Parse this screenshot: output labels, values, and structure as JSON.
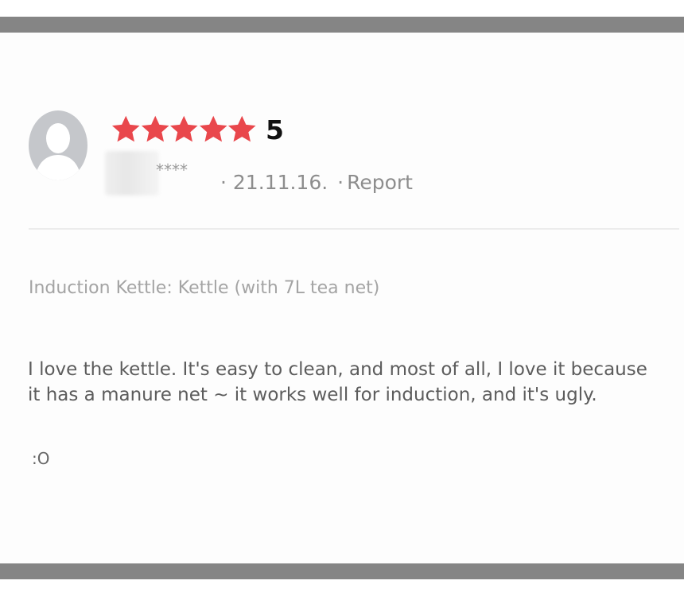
{
  "colors": {
    "bar": "#858585",
    "star": "#e9474c",
    "avatar_bg": "#c5c7cb",
    "avatar_fg": "#ffffff"
  },
  "review": {
    "rating": {
      "value": 5,
      "max": 5,
      "label": "5"
    },
    "reviewer_masked": "****",
    "date": "21.11.16.",
    "separator": "·",
    "report_label": "Report",
    "option_text": "Induction Kettle: Kettle (with 7L tea net)",
    "body": "I love the kettle. It's easy to clean, and most of all, I love it because it has a manure net ~ it works well for induction, and it's ugly.",
    "emote": ":O"
  },
  "icons": {
    "avatar": "person-silhouette-icon",
    "star": "star-icon"
  }
}
